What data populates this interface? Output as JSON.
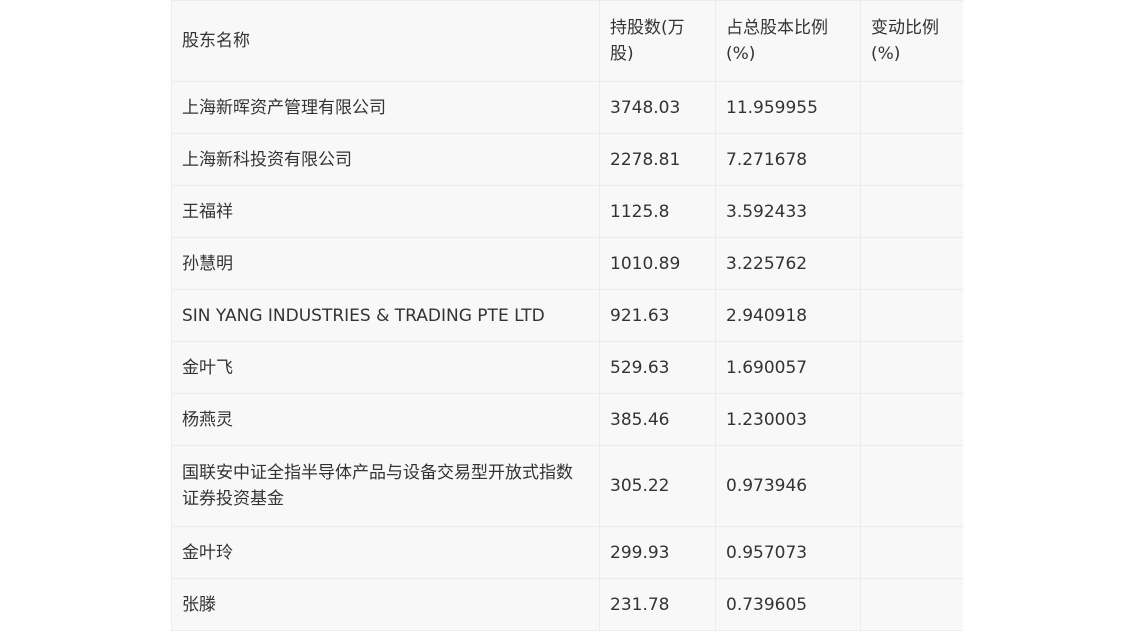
{
  "table": {
    "headers": {
      "name": "股东名称",
      "shares": "持股数(万股)",
      "ratio": "占总股本比例(%)",
      "change": "变动比例(%)"
    },
    "rows": [
      {
        "name": "上海新晖资产管理有限公司",
        "shares": "3748.03",
        "ratio": "11.959955",
        "change": ""
      },
      {
        "name": "上海新科投资有限公司",
        "shares": "2278.81",
        "ratio": "7.271678",
        "change": ""
      },
      {
        "name": "王福祥",
        "shares": "1125.8",
        "ratio": "3.592433",
        "change": ""
      },
      {
        "name": "孙慧明",
        "shares": "1010.89",
        "ratio": "3.225762",
        "change": ""
      },
      {
        "name": "SIN YANG INDUSTRIES & TRADING PTE LTD",
        "shares": "921.63",
        "ratio": "2.940918",
        "change": ""
      },
      {
        "name": "金叶飞",
        "shares": "529.63",
        "ratio": "1.690057",
        "change": ""
      },
      {
        "name": "杨燕灵",
        "shares": "385.46",
        "ratio": "1.230003",
        "change": ""
      },
      {
        "name": "国联安中证全指半导体产品与设备交易型开放式指数证券投资基金",
        "shares": "305.22",
        "ratio": "0.973946",
        "change": ""
      },
      {
        "name": "金叶玲",
        "shares": "299.93",
        "ratio": "0.957073",
        "change": ""
      },
      {
        "name": "张滕",
        "shares": "231.78",
        "ratio": "0.739605",
        "change": ""
      }
    ]
  }
}
